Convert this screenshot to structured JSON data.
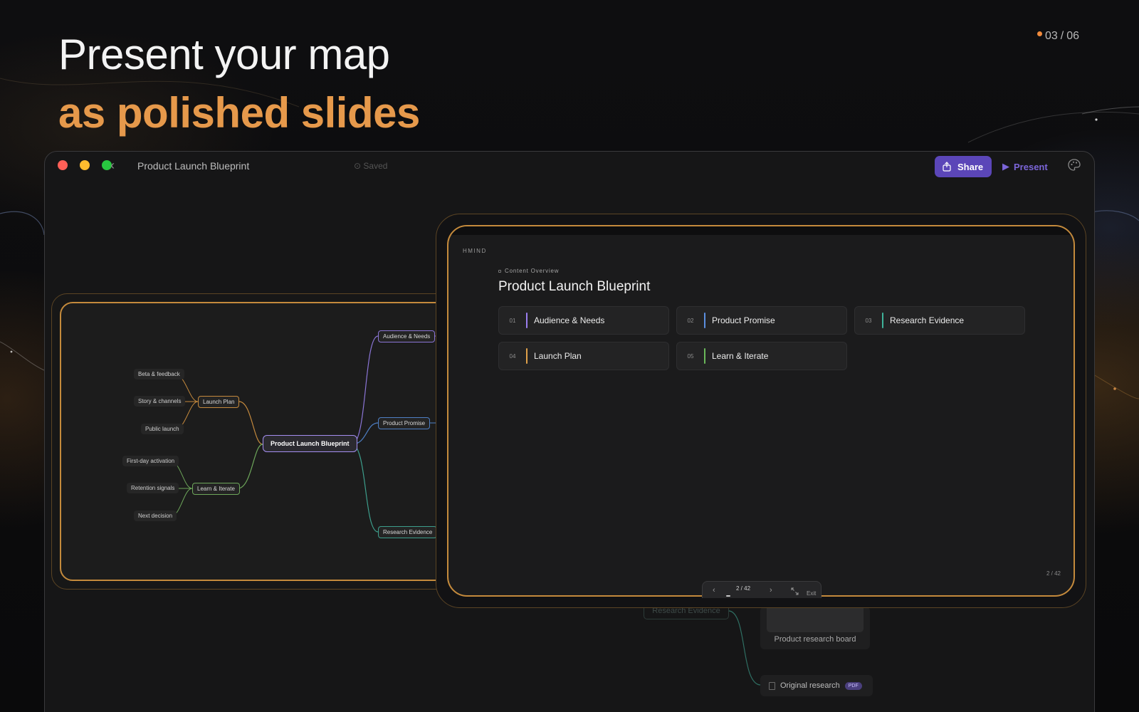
{
  "hero": {
    "line1": "Present your map",
    "line2": "as polished slides",
    "counter_current": "03",
    "counter_sep": "/",
    "counter_total": "06"
  },
  "window": {
    "title": "Product Launch Blueprint",
    "saved_status": "Saved",
    "share_label": "Share",
    "present_label": "Present"
  },
  "mindmap": {
    "center": "Product Launch Blueprint",
    "branches": {
      "audience": "Audience & Needs",
      "promise": "Product Promise",
      "evidence": "Research Evidence",
      "launch": "Launch Plan",
      "learn": "Learn & Iterate"
    },
    "launch_children": [
      "Beta & feedback",
      "Story & channels",
      "Public launch"
    ],
    "learn_children": [
      "First-day activation",
      "Retention signals",
      "Next decision"
    ]
  },
  "slide": {
    "brand": "HMIND",
    "section_label": "Content Overview",
    "title": "Product Launch Blueprint",
    "cards": [
      {
        "num": "01",
        "label": "Audience & Needs",
        "color": "#9b7ef0"
      },
      {
        "num": "02",
        "label": "Product Promise",
        "color": "#5b8fe0"
      },
      {
        "num": "03",
        "label": "Research Evidence",
        "color": "#3fb39a"
      },
      {
        "num": "04",
        "label": "Launch Plan",
        "color": "#e0a14a"
      },
      {
        "num": "05",
        "label": "Learn & Iterate",
        "color": "#6ab85a"
      }
    ],
    "page_no": "2 / 42"
  },
  "controls": {
    "page": "2 / 42",
    "exit_label": "Exit"
  },
  "canvas_below": {
    "ghost_node": "Research Evidence",
    "board_label": "Product research board",
    "original_label": "Original research",
    "pdf_badge": "PDF"
  },
  "colors": {
    "accent_orange": "#e6994b",
    "brand_purple": "#5b46b8",
    "frame_gold": "#c48a3c"
  }
}
